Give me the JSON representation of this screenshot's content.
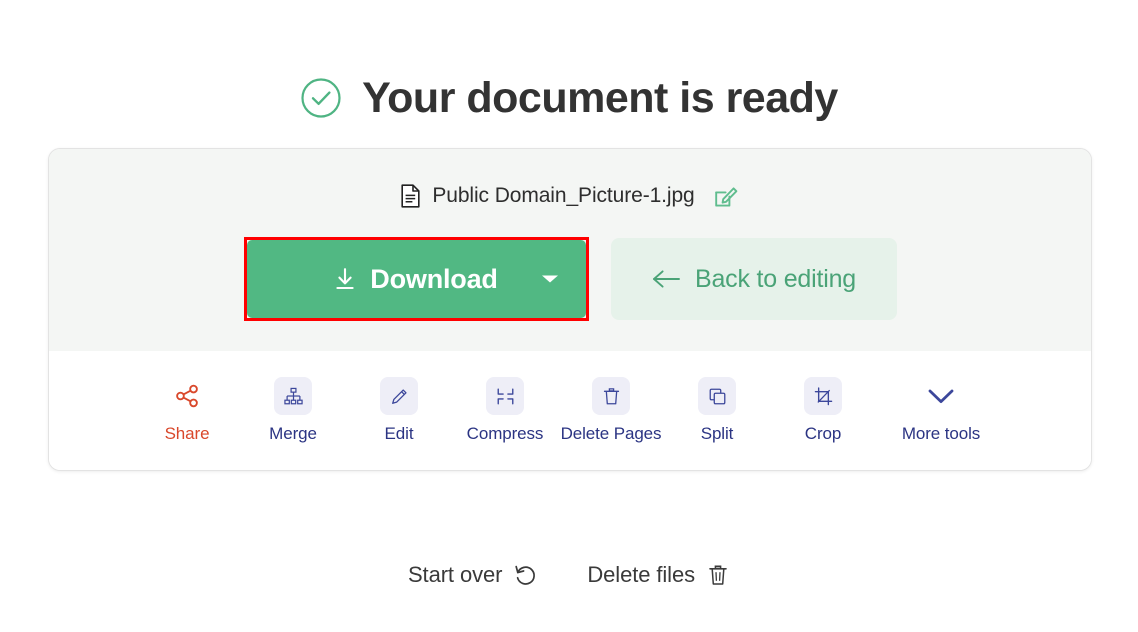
{
  "header": {
    "status_icon": "check-circle-icon",
    "title": "Your document is ready"
  },
  "file": {
    "doc_icon": "document-icon",
    "name": "Public Domain_Picture-1.jpg",
    "rename_icon": "edit-pencil-icon"
  },
  "actions": {
    "download": {
      "label": "Download",
      "icon": "download-arrow-icon",
      "caret": "caret-down-icon",
      "highlighted": true,
      "highlight_color": "#ff0000",
      "bg_color": "#51b883"
    },
    "back": {
      "label": "Back to editing",
      "icon": "arrow-left-icon",
      "bg_color": "#e6f2ea",
      "text_color": "#4aa377"
    }
  },
  "tools": [
    {
      "label": "Share",
      "icon": "share-nodes-icon",
      "boxed": false,
      "color": "#d9482b"
    },
    {
      "label": "Merge",
      "icon": "merge-tree-icon",
      "boxed": true,
      "color": "#2b3483"
    },
    {
      "label": "Edit",
      "icon": "pencil-icon",
      "boxed": true,
      "color": "#2b3483"
    },
    {
      "label": "Compress",
      "icon": "compress-icon",
      "boxed": true,
      "color": "#2b3483"
    },
    {
      "label": "Delete Pages",
      "icon": "trash-icon",
      "boxed": true,
      "color": "#2b3483"
    },
    {
      "label": "Split",
      "icon": "split-copy-icon",
      "boxed": true,
      "color": "#2b3483"
    },
    {
      "label": "Crop",
      "icon": "crop-icon",
      "boxed": true,
      "color": "#2b3483"
    },
    {
      "label": "More tools",
      "icon": "chevron-down-icon",
      "boxed": false,
      "color": "#2b3483"
    }
  ],
  "footer": [
    {
      "label": "Start over",
      "icon": "rotate-left-icon"
    },
    {
      "label": "Delete files",
      "icon": "trash-outline-icon"
    }
  ]
}
